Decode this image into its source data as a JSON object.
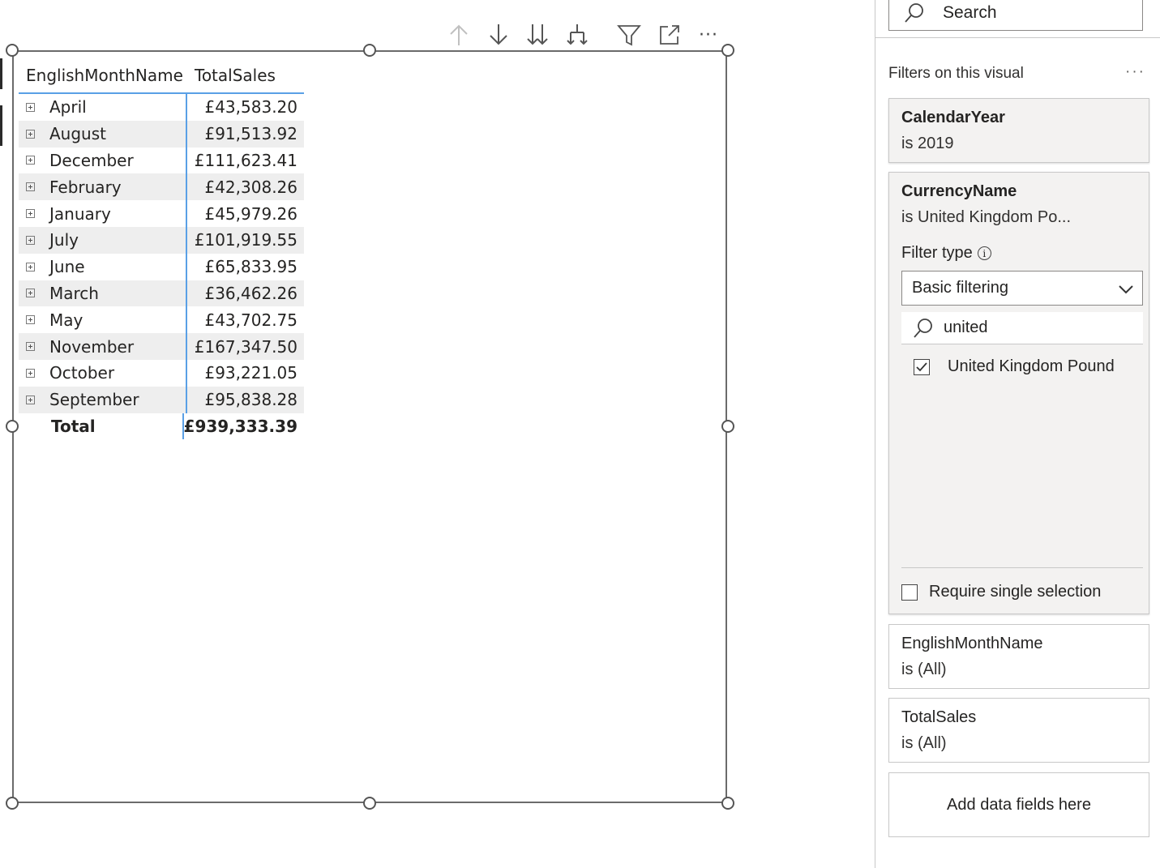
{
  "table": {
    "headers": [
      "EnglishMonthName",
      "TotalSales"
    ],
    "rows": [
      {
        "month": "April",
        "sales": "£43,583.20"
      },
      {
        "month": "August",
        "sales": "£91,513.92"
      },
      {
        "month": "December",
        "sales": "£111,623.41"
      },
      {
        "month": "February",
        "sales": "£42,308.26"
      },
      {
        "month": "January",
        "sales": "£45,979.26"
      },
      {
        "month": "July",
        "sales": "£101,919.55"
      },
      {
        "month": "June",
        "sales": "£65,833.95"
      },
      {
        "month": "March",
        "sales": "£36,462.26"
      },
      {
        "month": "May",
        "sales": "£43,702.75"
      },
      {
        "month": "November",
        "sales": "£167,347.50"
      },
      {
        "month": "October",
        "sales": "£93,221.05"
      },
      {
        "month": "September",
        "sales": "£95,838.28"
      }
    ],
    "total": {
      "label": "Total",
      "value": "£939,333.39"
    }
  },
  "toolbar": {
    "icons": [
      "arrow-up-icon",
      "arrow-down-icon",
      "double-arrow-down-icon",
      "expand-hierarchy-icon",
      "filter-icon",
      "focus-mode-icon",
      "more-options-icon"
    ],
    "more_label": "···"
  },
  "filter_pane": {
    "search_placeholder": "Search",
    "section_title": "Filters on this visual",
    "section_more": "···",
    "calendar_year": {
      "title": "CalendarYear",
      "value": "is 2019"
    },
    "currency": {
      "title": "CurrencyName",
      "value": "is United Kingdom Po...",
      "filter_type_label": "Filter type",
      "filter_type_value": "Basic filtering",
      "search_value": "united",
      "option_label": "United Kingdom Pound",
      "option_checked": true,
      "require_single": "Require single selection"
    },
    "month_filter": {
      "title": "EnglishMonthName",
      "value": "is (All)"
    },
    "sales_filter": {
      "title": "TotalSales",
      "value": "is (All)"
    },
    "add_fields": "Add data fields here"
  },
  "colors": {
    "accent_line": "#5aa0e6",
    "alt_row": "#eeeeee",
    "card_gray": "#f3f2f1"
  }
}
